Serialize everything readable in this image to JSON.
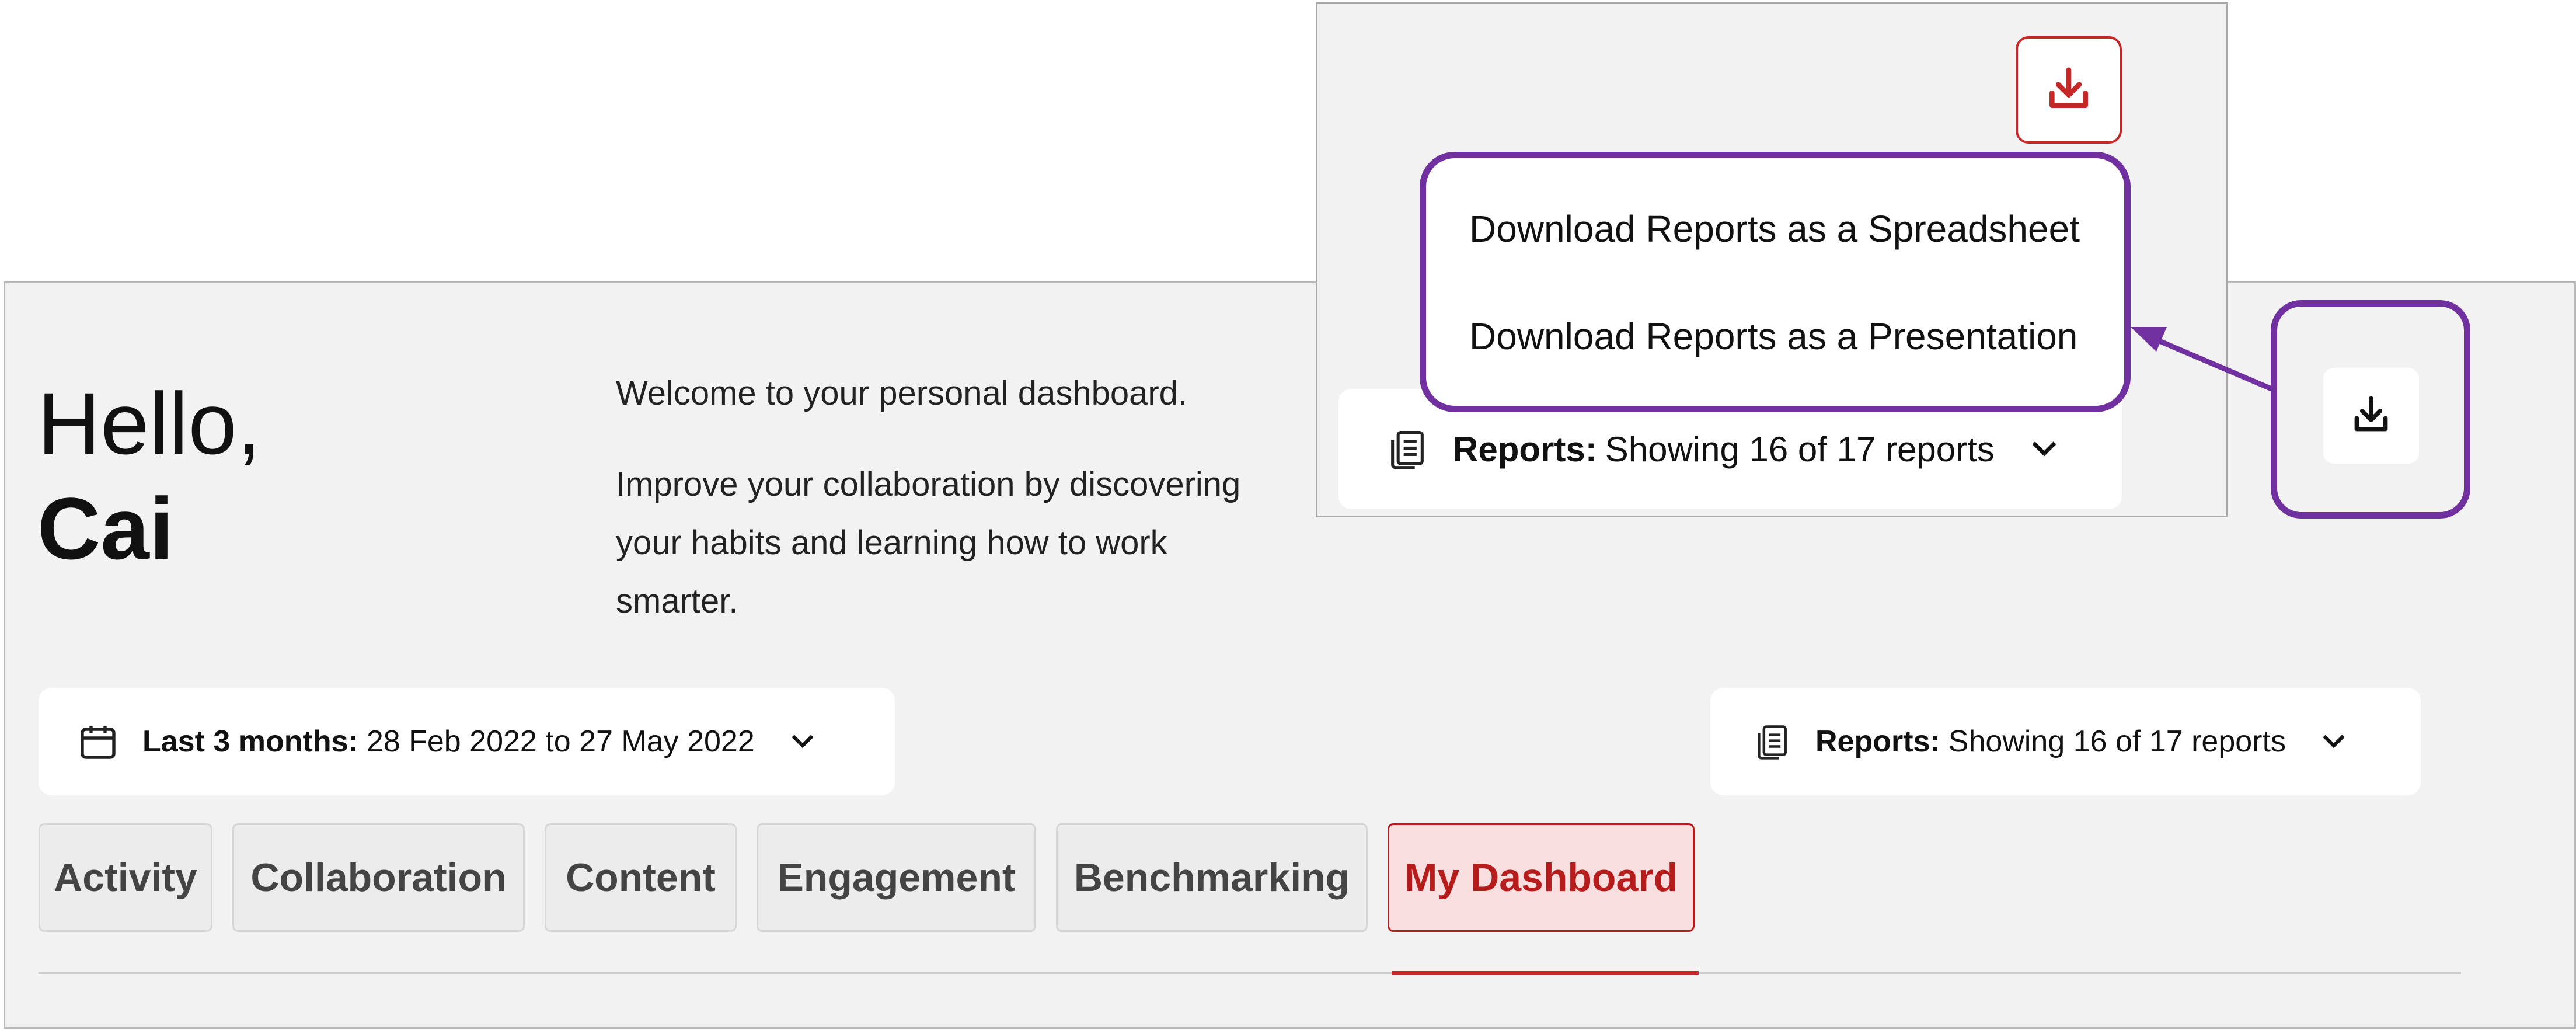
{
  "greeting": {
    "hello": "Hello,",
    "name": "Cai"
  },
  "welcome": {
    "line1": "Welcome to your personal dashboard.",
    "line2": "Improve your collaboration by discovering your habits and learning how to work smarter."
  },
  "date_filter": {
    "label": "Last 3 months:",
    "value": "28 Feb 2022 to 27 May 2022",
    "icon": "calendar-icon"
  },
  "reports_filter": {
    "label": "Reports:",
    "value": "Showing 16 of 17 reports",
    "icon": "documents-icon"
  },
  "tabs": [
    {
      "label": "Activity",
      "active": false
    },
    {
      "label": "Collaboration",
      "active": false
    },
    {
      "label": "Content",
      "active": false
    },
    {
      "label": "Engagement",
      "active": false
    },
    {
      "label": "Benchmarking",
      "active": false
    },
    {
      "label": "My Dashboard",
      "active": true
    }
  ],
  "download_menu": {
    "items": [
      {
        "label": "Download Reports as a Spreadsheet"
      },
      {
        "label": "Download Reports as a Presentation"
      }
    ]
  },
  "colors": {
    "accent": "#b71c1c",
    "highlight": "#7030a0",
    "panel": "#f2f2f2"
  }
}
